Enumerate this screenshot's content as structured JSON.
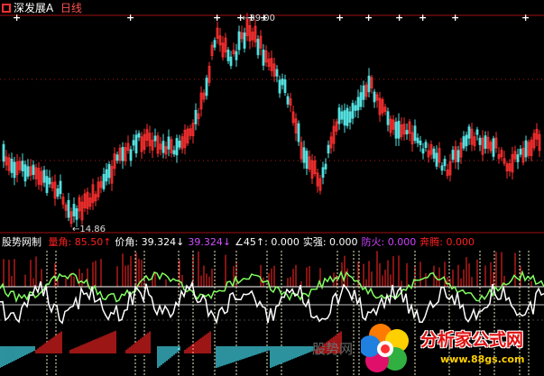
{
  "header": {
    "stock_name": "深发展A",
    "period": "日线",
    "colors": {
      "name": "#ffffff",
      "period": "#ff5050"
    }
  },
  "price_labels": {
    "high": "39.00",
    "low": "14.86"
  },
  "indicator_header": {
    "name": "股势网制",
    "items": [
      {
        "label": "量角:",
        "value": "85.50↑",
        "color": "#ff2020"
      },
      {
        "label": "价角:",
        "value": "39.324↓",
        "color": "#ffffff"
      },
      {
        "label": "",
        "value": "39.324↓",
        "color": "#d050ff"
      },
      {
        "label": "∠45↑:",
        "value": "0.000",
        "color": "#ffffff"
      },
      {
        "label": "实强:",
        "value": "0.000",
        "color": "#ffffff"
      },
      {
        "label": "防火:",
        "value": "0.000",
        "color": "#d040ff"
      },
      {
        "label": "奔腾:",
        "value": "0.000",
        "color": "#ff2020"
      }
    ]
  },
  "watermark": "股势网",
  "brand": {
    "name": "分析家公式网",
    "url": "www.88gs.com"
  },
  "colors": {
    "up_candle": "#ff3030",
    "down_candle": "#54e0e0",
    "grid_dot": "#b01818",
    "white_line": "#ffffff",
    "green_line": "#80ff60",
    "red_bar": "#e02020",
    "cyan_bar": "#40d0e0"
  },
  "chart_data": {
    "type": "candlestick",
    "high_marker": "39.00",
    "low_marker": "14.86",
    "x_markers": "white plus marks along top edge"
  }
}
